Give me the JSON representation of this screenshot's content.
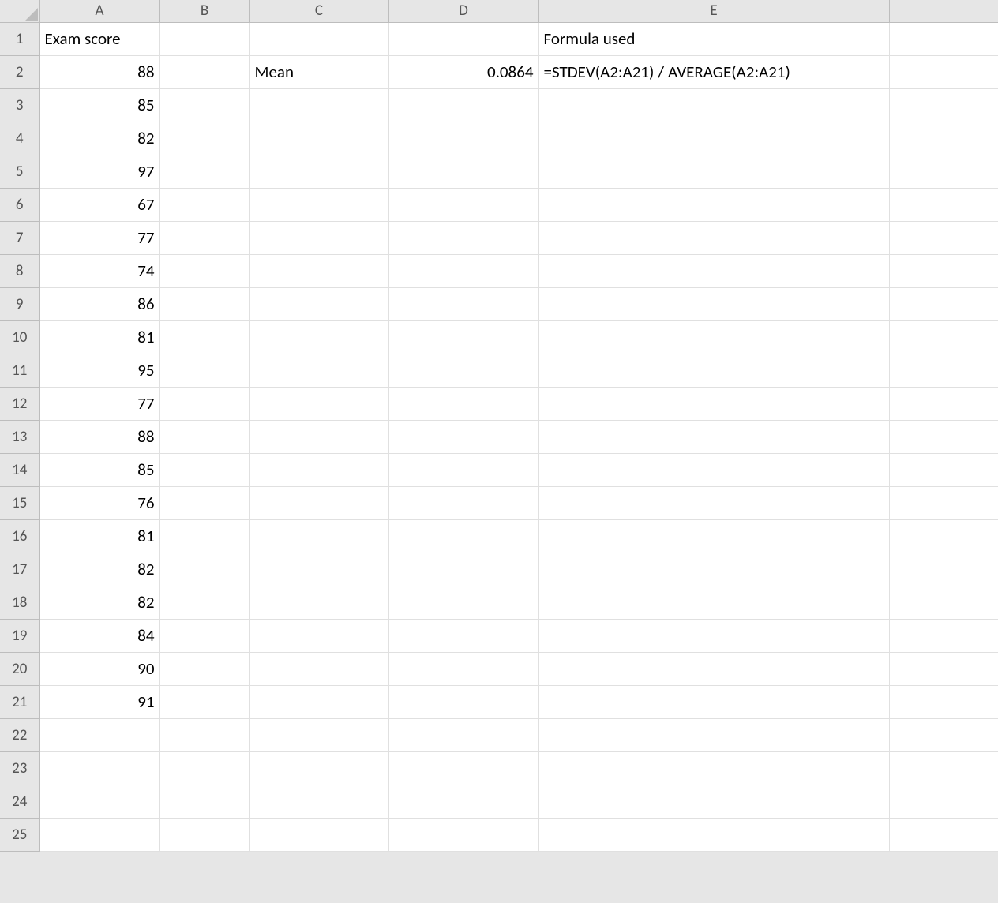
{
  "columns": [
    "A",
    "B",
    "C",
    "D",
    "E"
  ],
  "num_rows": 25,
  "cells": {
    "A1": {
      "text": "Exam score",
      "align": "left"
    },
    "E1": {
      "text": "Formula used",
      "align": "left"
    },
    "A2": {
      "text": "88",
      "align": "right"
    },
    "C2": {
      "text": "Mean",
      "align": "left"
    },
    "D2": {
      "text": "0.0864",
      "align": "right"
    },
    "E2": {
      "text": "=STDEV(A2:A21) / AVERAGE(A2:A21)",
      "align": "left"
    },
    "A3": {
      "text": "85",
      "align": "right"
    },
    "A4": {
      "text": "82",
      "align": "right"
    },
    "A5": {
      "text": "97",
      "align": "right"
    },
    "A6": {
      "text": "67",
      "align": "right"
    },
    "A7": {
      "text": "77",
      "align": "right"
    },
    "A8": {
      "text": "74",
      "align": "right"
    },
    "A9": {
      "text": "86",
      "align": "right"
    },
    "A10": {
      "text": "81",
      "align": "right"
    },
    "A11": {
      "text": "95",
      "align": "right"
    },
    "A12": {
      "text": "77",
      "align": "right"
    },
    "A13": {
      "text": "88",
      "align": "right"
    },
    "A14": {
      "text": "85",
      "align": "right"
    },
    "A15": {
      "text": "76",
      "align": "right"
    },
    "A16": {
      "text": "81",
      "align": "right"
    },
    "A17": {
      "text": "82",
      "align": "right"
    },
    "A18": {
      "text": "82",
      "align": "right"
    },
    "A19": {
      "text": "84",
      "align": "right"
    },
    "A20": {
      "text": "90",
      "align": "right"
    },
    "A21": {
      "text": "91",
      "align": "right"
    }
  }
}
